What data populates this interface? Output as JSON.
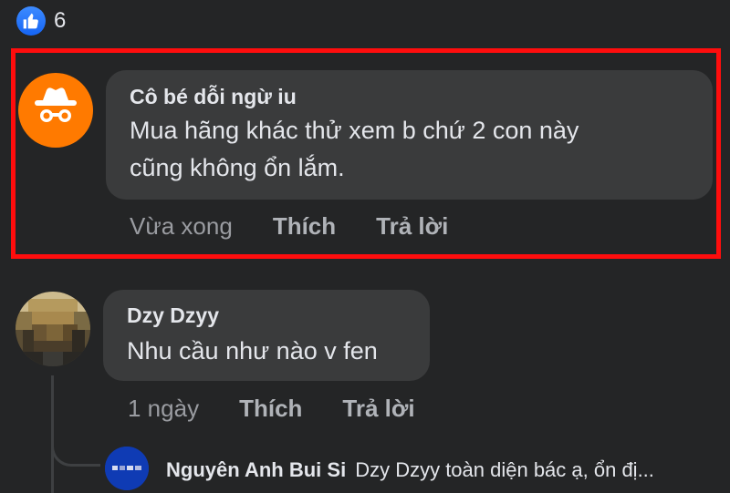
{
  "reactions": {
    "icon": "thumbs-up-icon",
    "count": "6",
    "color": "#1877f2"
  },
  "highlight": {
    "color": "#ff0d0d"
  },
  "comments": [
    {
      "author": "Cô bé dỗi ngừ iu",
      "avatar_icon": "incognito-icon",
      "avatar_color": "#ff7a00",
      "text_line1": "Mua hãng khác thử xem b chứ 2 con này",
      "text_line2": "cũng không ổn lắm.",
      "time": "Vừa xong",
      "like_label": "Thích",
      "reply_label": "Trả lời"
    },
    {
      "author": "Dzy Dzyy",
      "avatar_icon": "pixelated-avatar",
      "text": "Nhu cầu như nào v fen",
      "time": "1 ngày",
      "like_label": "Thích",
      "reply_label": "Trả lời"
    }
  ],
  "reply_preview": {
    "author": "Nguyên Anh Bui Si",
    "avatar_icon": "pixelated-avatar",
    "avatar_color": "#0f3bb4",
    "text": "Dzy Dzyy toàn diện bác ạ, ổn đị..."
  }
}
